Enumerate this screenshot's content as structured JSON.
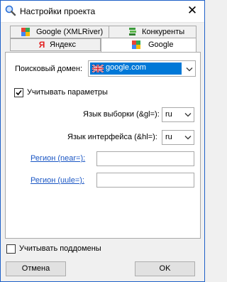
{
  "window": {
    "title": "Настройки проекта",
    "close_glyph": "✕"
  },
  "tabs": {
    "row1": [
      {
        "label": "Google (XMLRiver)",
        "icon": "google-icon"
      },
      {
        "label": "Конкуренты",
        "icon": "competitors-icon"
      }
    ],
    "row2": [
      {
        "label": "Яндекс",
        "icon": "yandex-icon"
      },
      {
        "label": "Google",
        "icon": "google-icon",
        "active": true
      }
    ]
  },
  "form": {
    "domain_label": "Поисковый домен:",
    "domain_value": "google.com",
    "use_params_label": "Учитывать параметры",
    "use_params_checked": true,
    "gl_label": "Язык выборки (&gl=):",
    "gl_value": "ru",
    "hl_label": "Язык интерфейса (&hl=):",
    "hl_value": "ru",
    "near_label": "Регион (near=):",
    "near_value": "",
    "uule_label": "Регион (uule=):",
    "uule_value": ""
  },
  "footer": {
    "subdomains_label": "Учитывать поддомены",
    "subdomains_checked": false,
    "cancel_label": "Отмена",
    "ok_label": "OK"
  },
  "colors": {
    "selection": "#0078d7",
    "link": "#1a56c4",
    "window_border": "#1e60c8"
  }
}
